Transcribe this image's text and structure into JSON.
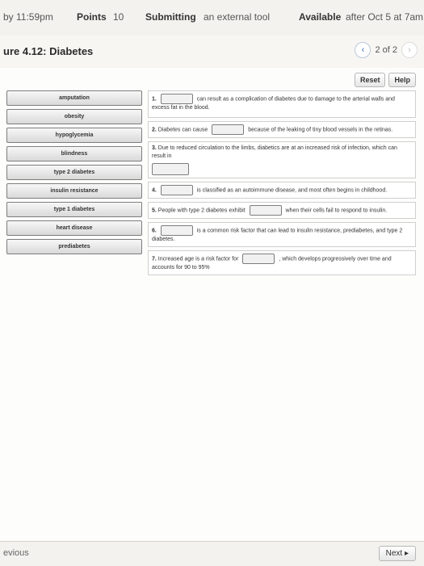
{
  "header": {
    "due": "by 11:59pm",
    "points_label": "Points",
    "points_value": "10",
    "submitting_label": "Submitting",
    "submitting_value": "an external tool",
    "available_label": "Available",
    "available_value": "after Oct 5 at 7am"
  },
  "title": "ure 4.12: Diabetes",
  "pager": {
    "prev_icon": "chevron-left-icon",
    "text": "2 of 2",
    "next_icon": "chevron-right-icon"
  },
  "toolbar": {
    "reset": "Reset",
    "help": "Help"
  },
  "word_bank": [
    "amputation",
    "obesity",
    "hypoglycemia",
    "blindness",
    "type 2 diabetes",
    "insulin resistance",
    "type 1 diabetes",
    "heart disease",
    "prediabetes"
  ],
  "questions": [
    {
      "num": "1.",
      "after": "can result as a complication of diabetes due to damage to the arterial walls and excess fat in the blood."
    },
    {
      "num": "2.",
      "before": "Diabetes can cause",
      "after": "because of the leaking of tiny blood vessels in the retinas."
    },
    {
      "num": "3.",
      "before": "Due to reduced circulation to the limbs, diabetics are at an increased risk of infection, which can result in"
    },
    {
      "num": "4.",
      "after": "is classified as an autoimmune disease, and most often begins in childhood."
    },
    {
      "num": "5.",
      "before": "People with type 2 diabetes exhibit",
      "after": "when their cells fail to respond to insulin."
    },
    {
      "num": "6.",
      "after": "is a common risk factor that can lead to insulin resistance, prediabetes, and type 2 diabetes."
    },
    {
      "num": "7.",
      "before": "Increased age is a risk factor for",
      "after": ", which develops progressively over time and accounts for 90 to 95%"
    }
  ],
  "footer": {
    "previous": "evious",
    "next": "Next ▸"
  }
}
